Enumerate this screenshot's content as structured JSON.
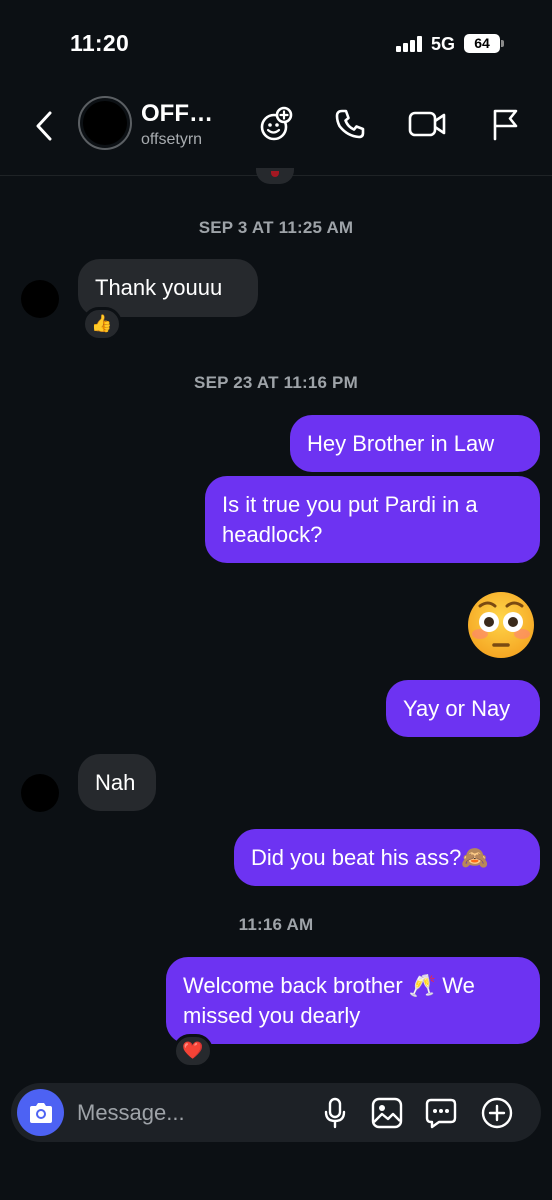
{
  "status_bar": {
    "time": "11:20",
    "network": "5G",
    "battery": "64"
  },
  "header": {
    "name": "OFF…",
    "handle": "offsetyrn"
  },
  "icons": {
    "back": "chevron-left-icon",
    "effects": "add-effects-icon",
    "call": "phone-icon",
    "video": "video-camera-icon",
    "flag": "flag-icon",
    "camera": "camera-icon",
    "mic": "microphone-icon",
    "gallery": "image-icon",
    "sticker": "chat-bubble-icon",
    "add": "plus-circle-icon"
  },
  "colors": {
    "background": "#0c1014",
    "outgoing_bubble": "#6d33f2",
    "incoming_bubble": "#26292d",
    "camera_button": "#4d62f3"
  },
  "chat": {
    "ts1": "SEP 3 AT 11:25 AM",
    "msg1": "Thank youuu",
    "react1": "👍",
    "ts2": "SEP 23 AT 11:16 PM",
    "msg2": "Hey Brother in Law",
    "msg3_line1": "Is it true you put Pardi in a",
    "msg3_line2": "headlock?",
    "emoji_msg": "😳",
    "msg4": "Yay or Nay",
    "msg5": "Nah",
    "msg6": "Did you beat his ass?🙈",
    "ts3": "11:16 AM",
    "msg7_line1": "Welcome back brother 🥂  We",
    "msg7_line2": "missed you dearly",
    "react7": "❤️"
  },
  "composer": {
    "placeholder": "Message..."
  }
}
